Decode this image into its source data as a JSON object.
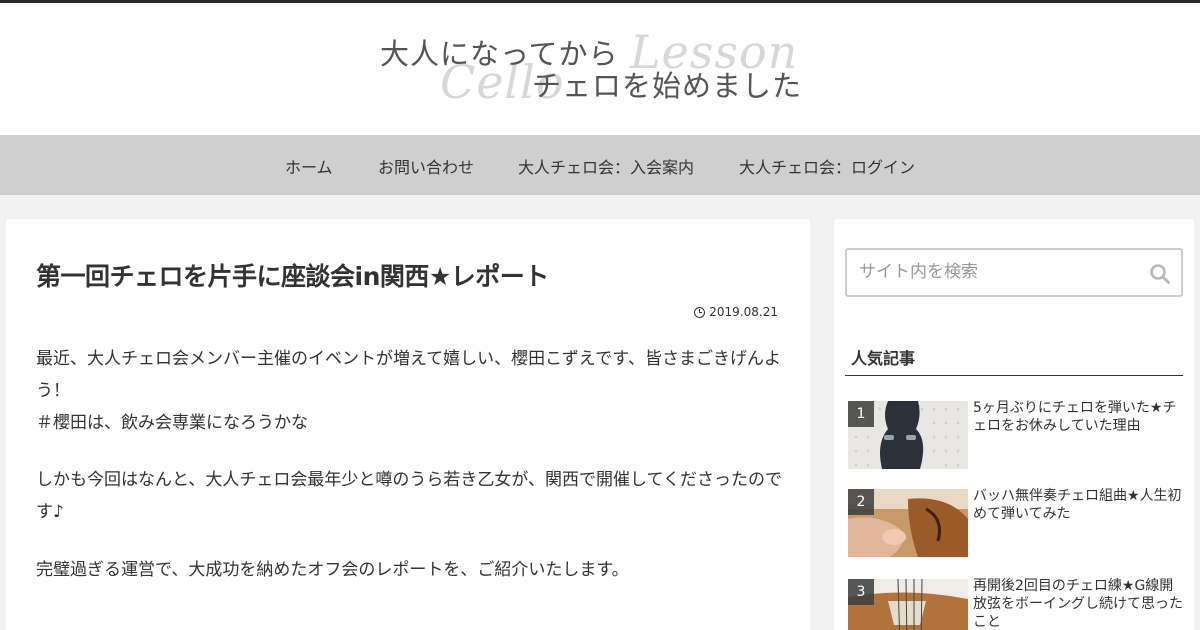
{
  "site": {
    "logo_line1": "大人になってから",
    "logo_line2": "チェロを始めました",
    "logo_script1": "Lesson",
    "logo_script2": "Cello"
  },
  "nav": {
    "items": [
      {
        "label": "ホーム"
      },
      {
        "label": "お問い合わせ"
      },
      {
        "label": "大人チェロ会：入会案内"
      },
      {
        "label": "大人チェロ会：ログイン"
      }
    ]
  },
  "post": {
    "title": "第一回チェロを片手に座談会in関西★レポート",
    "date": "2019.08.21",
    "paragraphs": [
      "最近、大人チェロ会メンバー主催のイベントが増えて嬉しい、櫻田こずえです、皆さまごきげんよう！",
      "＃櫻田は、飲み会専業になろうかな",
      "しかも今回はなんと、大人チェロ会最年少と噂のうら若き乙女が、関西で開催してくださったのです♪",
      "完璧過ぎる運営で、大成功を納めたオフ会のレポートを、ご紹介いたします。"
    ]
  },
  "sidebar": {
    "search_placeholder": "サイト内を検索",
    "popular_title": "人気記事",
    "popular": [
      {
        "rank": "1",
        "title": "5ヶ月ぶりにチェロを弾いた★チェロをお休みしていた理由"
      },
      {
        "rank": "2",
        "title": "バッハ無伴奏チェロ組曲★人生初めて弾いてみた"
      },
      {
        "rank": "3",
        "title": "再開後2回目のチェロ練★G線開放弦をボーイングし続けて思ったこと"
      }
    ]
  },
  "colors": {
    "topbar": "#2a2a2a",
    "nav_bg": "#cfcfcf",
    "page_bg": "#f2f2f2",
    "rule": "#333333"
  },
  "icons": {
    "search": "search-icon",
    "clock": "clock-icon"
  }
}
